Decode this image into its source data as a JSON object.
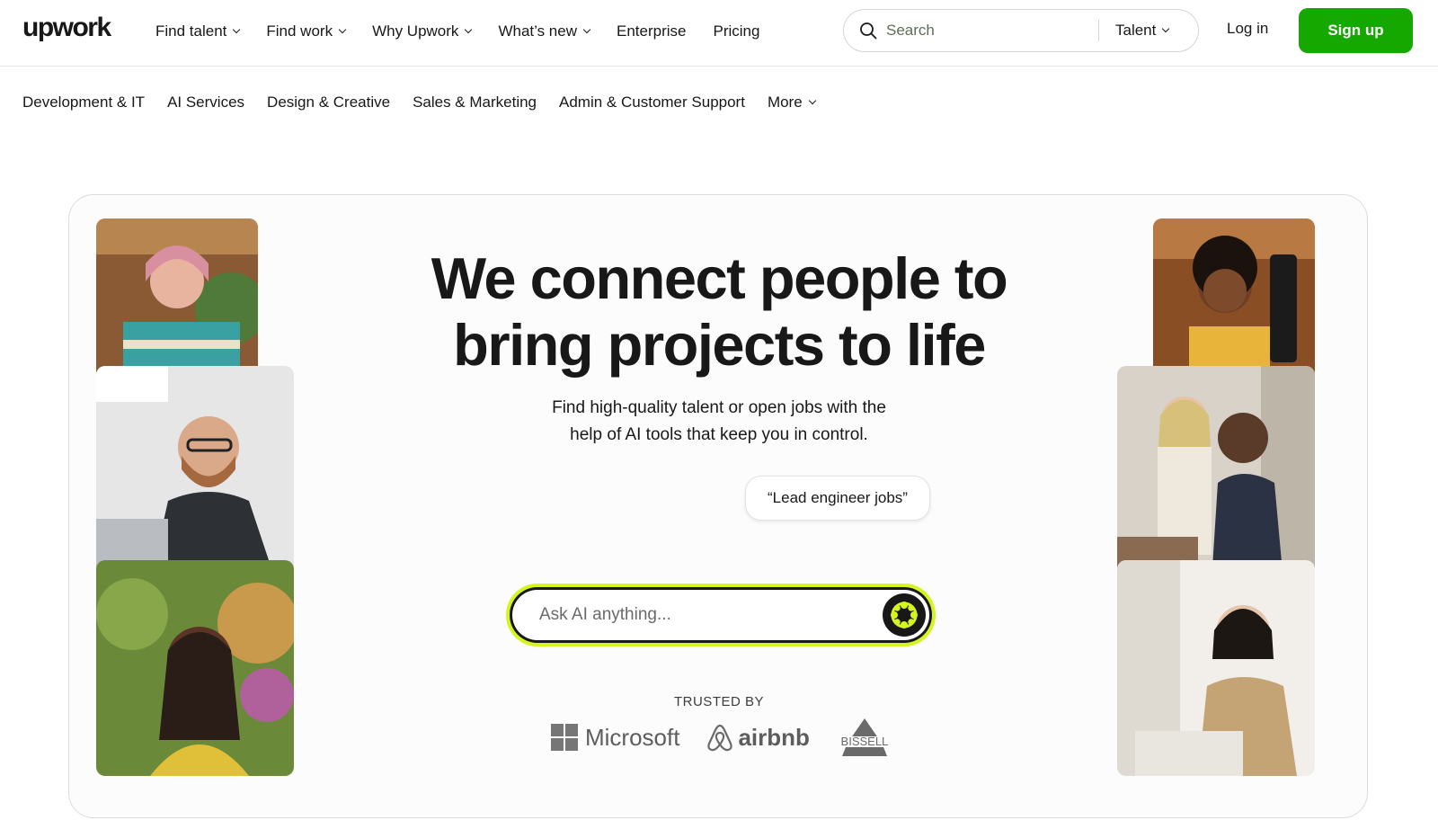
{
  "header": {
    "logo": "upwork",
    "nav": [
      {
        "label": "Find talent",
        "dropdown": true
      },
      {
        "label": "Find work",
        "dropdown": true
      },
      {
        "label": "Why Upwork",
        "dropdown": true
      },
      {
        "label": "What’s new",
        "dropdown": true
      },
      {
        "label": "Enterprise",
        "dropdown": false
      },
      {
        "label": "Pricing",
        "dropdown": false
      }
    ],
    "search": {
      "placeholder": "Search",
      "scope": "Talent"
    },
    "login": "Log in",
    "signup": "Sign up"
  },
  "categories": {
    "items": [
      "Development & IT",
      "AI Services",
      "Design & Creative",
      "Sales & Marketing",
      "Admin & Customer Support"
    ],
    "more": "More"
  },
  "hero": {
    "headline_line1": "We connect people to",
    "headline_line2": "bring projects to life",
    "subhead_line1": "Find high-quality talent or open jobs with the",
    "subhead_line2": "help of AI tools that keep you in control.",
    "suggestion": "“Lead engineer jobs”",
    "ask_placeholder": "Ask AI anything...",
    "trusted_by": "TRUSTED BY",
    "brands": [
      "Microsoft",
      "airbnb",
      "BISSELL"
    ]
  },
  "colors": {
    "brand_green": "#14a800",
    "ai_accent": "#d6f51e",
    "text": "#181818"
  },
  "icons": [
    "search-icon",
    "chevron-down-icon",
    "ai-sparkle-icon",
    "microsoft-logo",
    "airbnb-logo",
    "bissell-logo"
  ]
}
